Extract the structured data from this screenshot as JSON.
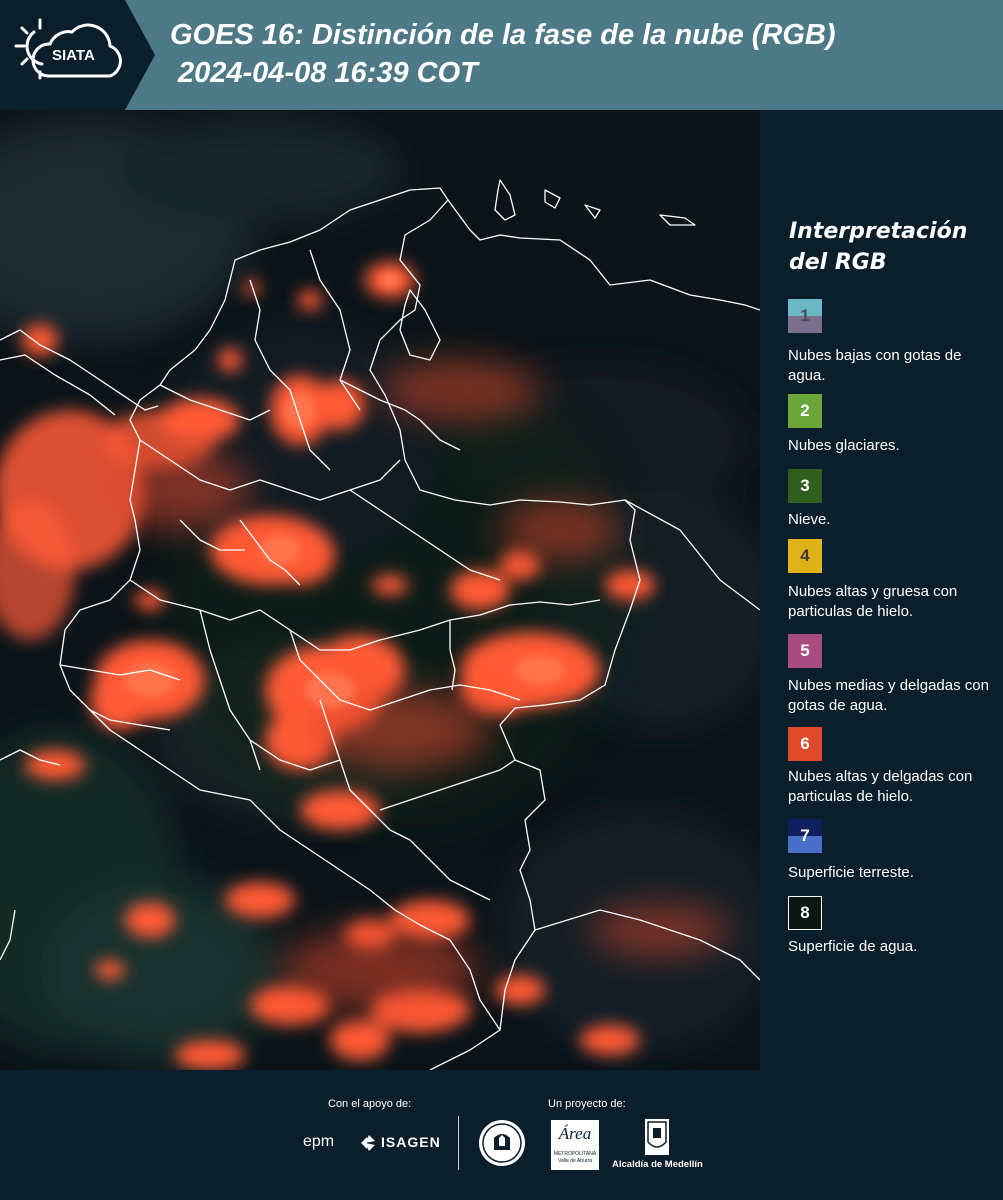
{
  "header": {
    "logo_text": "SIATA",
    "title_line1": "GOES 16: Distinción de la fase de la nube (RGB)",
    "title_line2": "2024-04-08 16:39 COT"
  },
  "legend": {
    "title_line1": "Interpretación",
    "title_line2": "del RGB",
    "items": [
      {
        "number": "1",
        "label": "Nubes bajas con gotas de agua.",
        "color_top": "#6bb8c6",
        "color_bottom": "#7a6f8c"
      },
      {
        "number": "2",
        "label": "Nubes glaciares.",
        "color": "#6aa63a"
      },
      {
        "number": "3",
        "label": "Nieve.",
        "color": "#2f5e1f"
      },
      {
        "number": "4",
        "label": "Nubes altas y gruesa con particulas de hielo.",
        "color": "#e0b21a"
      },
      {
        "number": "5",
        "label": "Nubes medias y delgadas con gotas de agua.",
        "color": "#a84c82"
      },
      {
        "number": "6",
        "label": "Nubes altas y delgadas con particulas de hielo.",
        "color": "#e0482a"
      },
      {
        "number": "7",
        "label": "Superficie terreste.",
        "color_top": "#0d1f5c",
        "color_bottom": "#4a6fc8"
      },
      {
        "number": "8",
        "label": "Superficie de agua.",
        "color": "#0b1712"
      }
    ]
  },
  "footer": {
    "support_label": "Con el apoyo de:",
    "support_brands": [
      "epm",
      "ISAGEN"
    ],
    "project_label": "Un proyecto de:",
    "amva_text": "Área",
    "amva_sub": "METROPOLITANA",
    "amva_sub2": "Valle de Aburrá",
    "alcaldia": "Alcaldía de Medellín"
  },
  "colors": {
    "header_bg": "#4e7a88",
    "panel_bg": "#0b1e2b",
    "cloud_ice": "#ff5a36",
    "border_white": "#ffffff"
  }
}
